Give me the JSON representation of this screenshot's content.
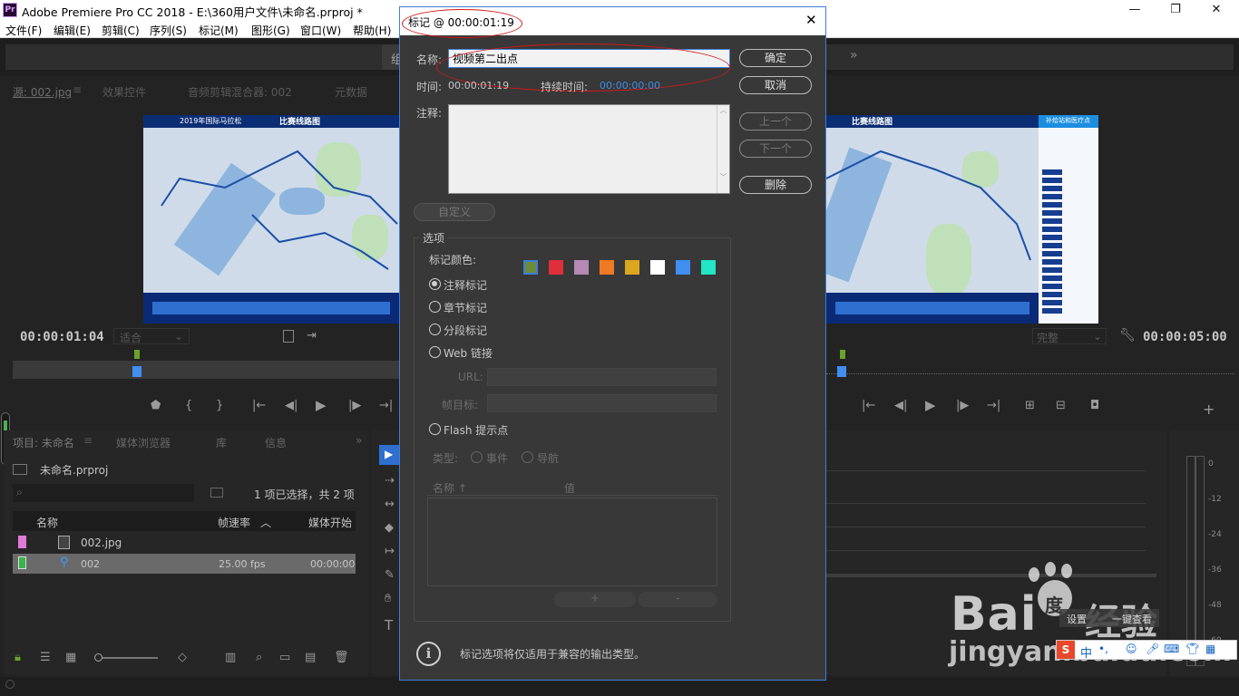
{
  "app": {
    "title": "Adobe Premiere Pro CC 2018 - E:\\360用户文件\\未命名.prproj *",
    "icon_label": "Pr",
    "window_controls": [
      "—",
      "☐",
      "✕"
    ]
  },
  "menu": [
    "文件(F)",
    "编辑(E)",
    "剪辑(C)",
    "序列(S)",
    "标记(M)",
    "图形(G)",
    "窗口(W)",
    "帮助(H)"
  ],
  "workspace": {
    "visible_char": "组",
    "overflow": "»"
  },
  "source_panel": {
    "tabs": [
      "源: 002.jpg",
      "效果控件",
      "音频剪辑混合器: 002",
      "元数据"
    ],
    "timecode": "00:00:01:04",
    "fit": "适合"
  },
  "program_panel": {
    "quality": "完整",
    "timecode": "00:00:05:00"
  },
  "map": {
    "year_title": "2019年国际马拉松",
    "title": "比赛线路图",
    "legend_title": "补给站和医疗点"
  },
  "project_panel": {
    "tabs": [
      "项目: 未命名",
      "媒体浏览器",
      "库",
      "信息"
    ],
    "project_file": "未命名.prproj",
    "selection_status": "1 项已选择，共 2 项",
    "columns": [
      "名称",
      "帧速率",
      "媒体开始"
    ],
    "items": [
      {
        "name": "002.jpg",
        "fps": "",
        "start": "",
        "color": "#e07ad6"
      },
      {
        "name": "002",
        "fps": "25.00 fps",
        "start": "00:00:00:0",
        "color": "#39b34a"
      }
    ]
  },
  "audio_meter": {
    "scale": [
      "0",
      "-12",
      "-24",
      "-36",
      "-48",
      "-60"
    ]
  },
  "dialog": {
    "title": "标记 @ 00:00:01:19",
    "name_label": "名称:",
    "name_value": "视频第二出点",
    "time_label": "时间:",
    "time_value": "00:00:01:19",
    "duration_label": "持续时间:",
    "duration_value": "00:00:00:00",
    "comment_label": "注释:",
    "buttons": {
      "ok": "确定",
      "cancel": "取消",
      "prev": "上一个",
      "next": "下一个",
      "delete": "删除",
      "custom": "自定义"
    },
    "options_label": "选项",
    "marker_color_label": "标记颜色:",
    "colors": [
      "#6b8a3a",
      "#e02e3a",
      "#b48ab5",
      "#f07a24",
      "#dca71f",
      "#ffffff",
      "#3f8ef0",
      "#22e6c4"
    ],
    "marker_types": [
      "注释标记",
      "章节标记",
      "分段标记",
      "Web 链接"
    ],
    "url_label": "URL:",
    "frame_target_label": "帧目标:",
    "flash_label": "Flash 提示点",
    "type_label": "类型:",
    "type_event": "事件",
    "type_nav": "导航",
    "param_name": "名称 ↑",
    "param_value": "值",
    "add_btn": "+",
    "remove_btn": "-",
    "info_text": "标记选项将仅适用于兼容的输出类型。"
  },
  "watermark": {
    "brand": "Bai",
    "paw": "度",
    "jingyan": "经验",
    "url": "jingyan.baidu.com"
  },
  "tray": {
    "ime_items": [
      "设置",
      "一键查看"
    ],
    "zh": "中"
  }
}
